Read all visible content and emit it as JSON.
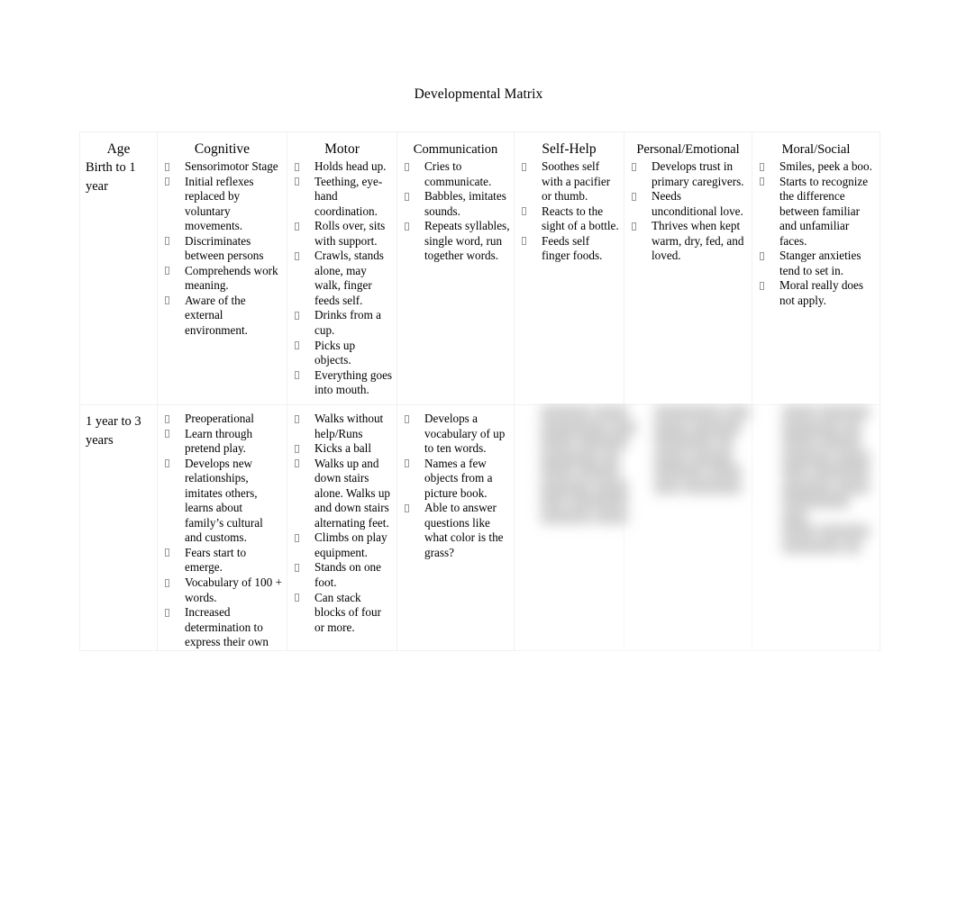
{
  "document": {
    "title": "Developmental Matrix"
  },
  "table": {
    "headers": [
      "Age",
      "Cognitive",
      "Motor",
      "Communication",
      "Self-Help",
      "Personal/Emotional",
      "Moral/Social"
    ],
    "rows": [
      {
        "age": "Birth to 1 year",
        "cognitive": [
          "Sensorimotor Stage",
          "Initial reflexes replaced by voluntary movements.",
          "Discriminates between persons",
          "Comprehends work meaning.",
          "Aware of the external environment."
        ],
        "motor": [
          "Holds head up.",
          "Teething, eye-hand coordination.",
          "Rolls over, sits with support.",
          "Crawls, stands alone, may walk, finger feeds self.",
          "Drinks from a cup.",
          "Picks up objects.",
          "Everything goes into mouth."
        ],
        "communication": [
          "Cries to communicate.",
          "Babbles, imitates sounds.",
          "Repeats syllables, single word, run together words."
        ],
        "self_help": [
          "Soothes self with a pacifier or thumb.",
          "Reacts to the sight of a bottle.",
          "Feeds self finger foods."
        ],
        "personal_emotional": [
          "Develops trust in primary caregivers.",
          "Needs unconditional love.",
          "Thrives when kept warm, dry, fed, and loved."
        ],
        "moral_social": [
          "Smiles, peek a boo.",
          "Starts to recognize the difference between familiar and unfamiliar faces.",
          "Stanger anxieties tend to set in.",
          "Moral really does not apply."
        ]
      },
      {
        "age": "1 year to 3 years",
        "cognitive": [
          "Preoperational",
          "Learn through pretend play.",
          "Develops new relationships, imitates others, learns about family’s cultural and customs.",
          "Fears start to emerge.",
          "Vocabulary of 100 + words.",
          "Increased determination to express their own"
        ],
        "motor": [
          "Walks without help/Runs",
          "Kicks a ball",
          "Walks up and down stairs alone. Walks up and down stairs alternating feet.",
          "Climbs on play equipment.",
          "Stands on one foot.",
          "Can stack blocks of four or more."
        ],
        "communication": [
          "Develops a vocabulary of up to ten words.",
          "Names a few objects from a picture book.",
          "Able to answer questions like what color is the grass?"
        ],
        "self_help": [],
        "personal_emotional": [],
        "moral_social": []
      }
    ]
  },
  "obscured": {
    "note": "illegible blurred text",
    "placeholder_lines": [
      "██████ ████",
      "████████ ███",
      "████ ██████",
      "███████ ██",
      "████ █████",
      "██████ ████",
      "███ ███████"
    ]
  }
}
